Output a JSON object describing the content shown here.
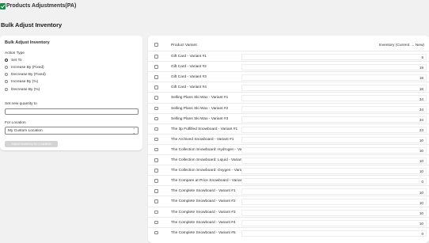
{
  "app": {
    "title": "Products Adjustments(PA)"
  },
  "page": {
    "title": "Bulk Adjust Inventory"
  },
  "form": {
    "title": "Bulk Adjust Inventory",
    "action_label": "Action Type",
    "actions": [
      {
        "label": "Set To",
        "checked": true
      },
      {
        "label": "Increase By (Fixed)",
        "checked": false
      },
      {
        "label": "Decrease By (Fixed)",
        "checked": false
      },
      {
        "label": "Increase By (%)",
        "checked": false
      },
      {
        "label": "Decrease By (%)",
        "checked": false
      }
    ],
    "quantity_label": "Set new quantity to",
    "quantity_value": "",
    "location_label": "For Location",
    "location_value": "My Custom Location",
    "submit_label": "Adjust Inventory for 1 variants"
  },
  "table": {
    "col_variant": "Product Variant",
    "col_inventory": "Inventory (Current → New)",
    "rows": [
      {
        "name": "Gift Card - Variant #1",
        "qty": "6"
      },
      {
        "name": "Gift Card - Variant #2",
        "qty": "19"
      },
      {
        "name": "Gift Card - Variant #3",
        "qty": "18"
      },
      {
        "name": "Gift Card - Variant #4",
        "qty": "18"
      },
      {
        "name": "Selling Plans Ski Wax - Variant #1",
        "qty": "34"
      },
      {
        "name": "Selling Plans Ski Wax - Variant #2",
        "qty": "34"
      },
      {
        "name": "Selling Plans Ski Wax - Variant #3",
        "qty": "34"
      },
      {
        "name": "The 3p Fulfilled Snowboard - Variant #1",
        "qty": "23"
      },
      {
        "name": "The Archived Snowboard - Variant #1",
        "qty": "10"
      },
      {
        "name": "The Collection Snowboard: Hydrogen - Variant #1",
        "qty": "10"
      },
      {
        "name": "The Collection Snowboard: Liquid - Variant #1",
        "qty": "10"
      },
      {
        "name": "The Collection Snowboard: Oxygen - Variant #1",
        "qty": "10"
      },
      {
        "name": "The Compare at Price Snowboard - Variant #1",
        "qty": "0"
      },
      {
        "name": "The Complete Snowboard - Variant #1",
        "qty": "10"
      },
      {
        "name": "The Complete Snowboard - Variant #2",
        "qty": "10"
      },
      {
        "name": "The Complete Snowboard - Variant #3",
        "qty": "10"
      },
      {
        "name": "The Complete Snowboard - Variant #4",
        "qty": "10"
      },
      {
        "name": "The Complete Snowboard - Variant #5",
        "qty": "0"
      }
    ]
  }
}
